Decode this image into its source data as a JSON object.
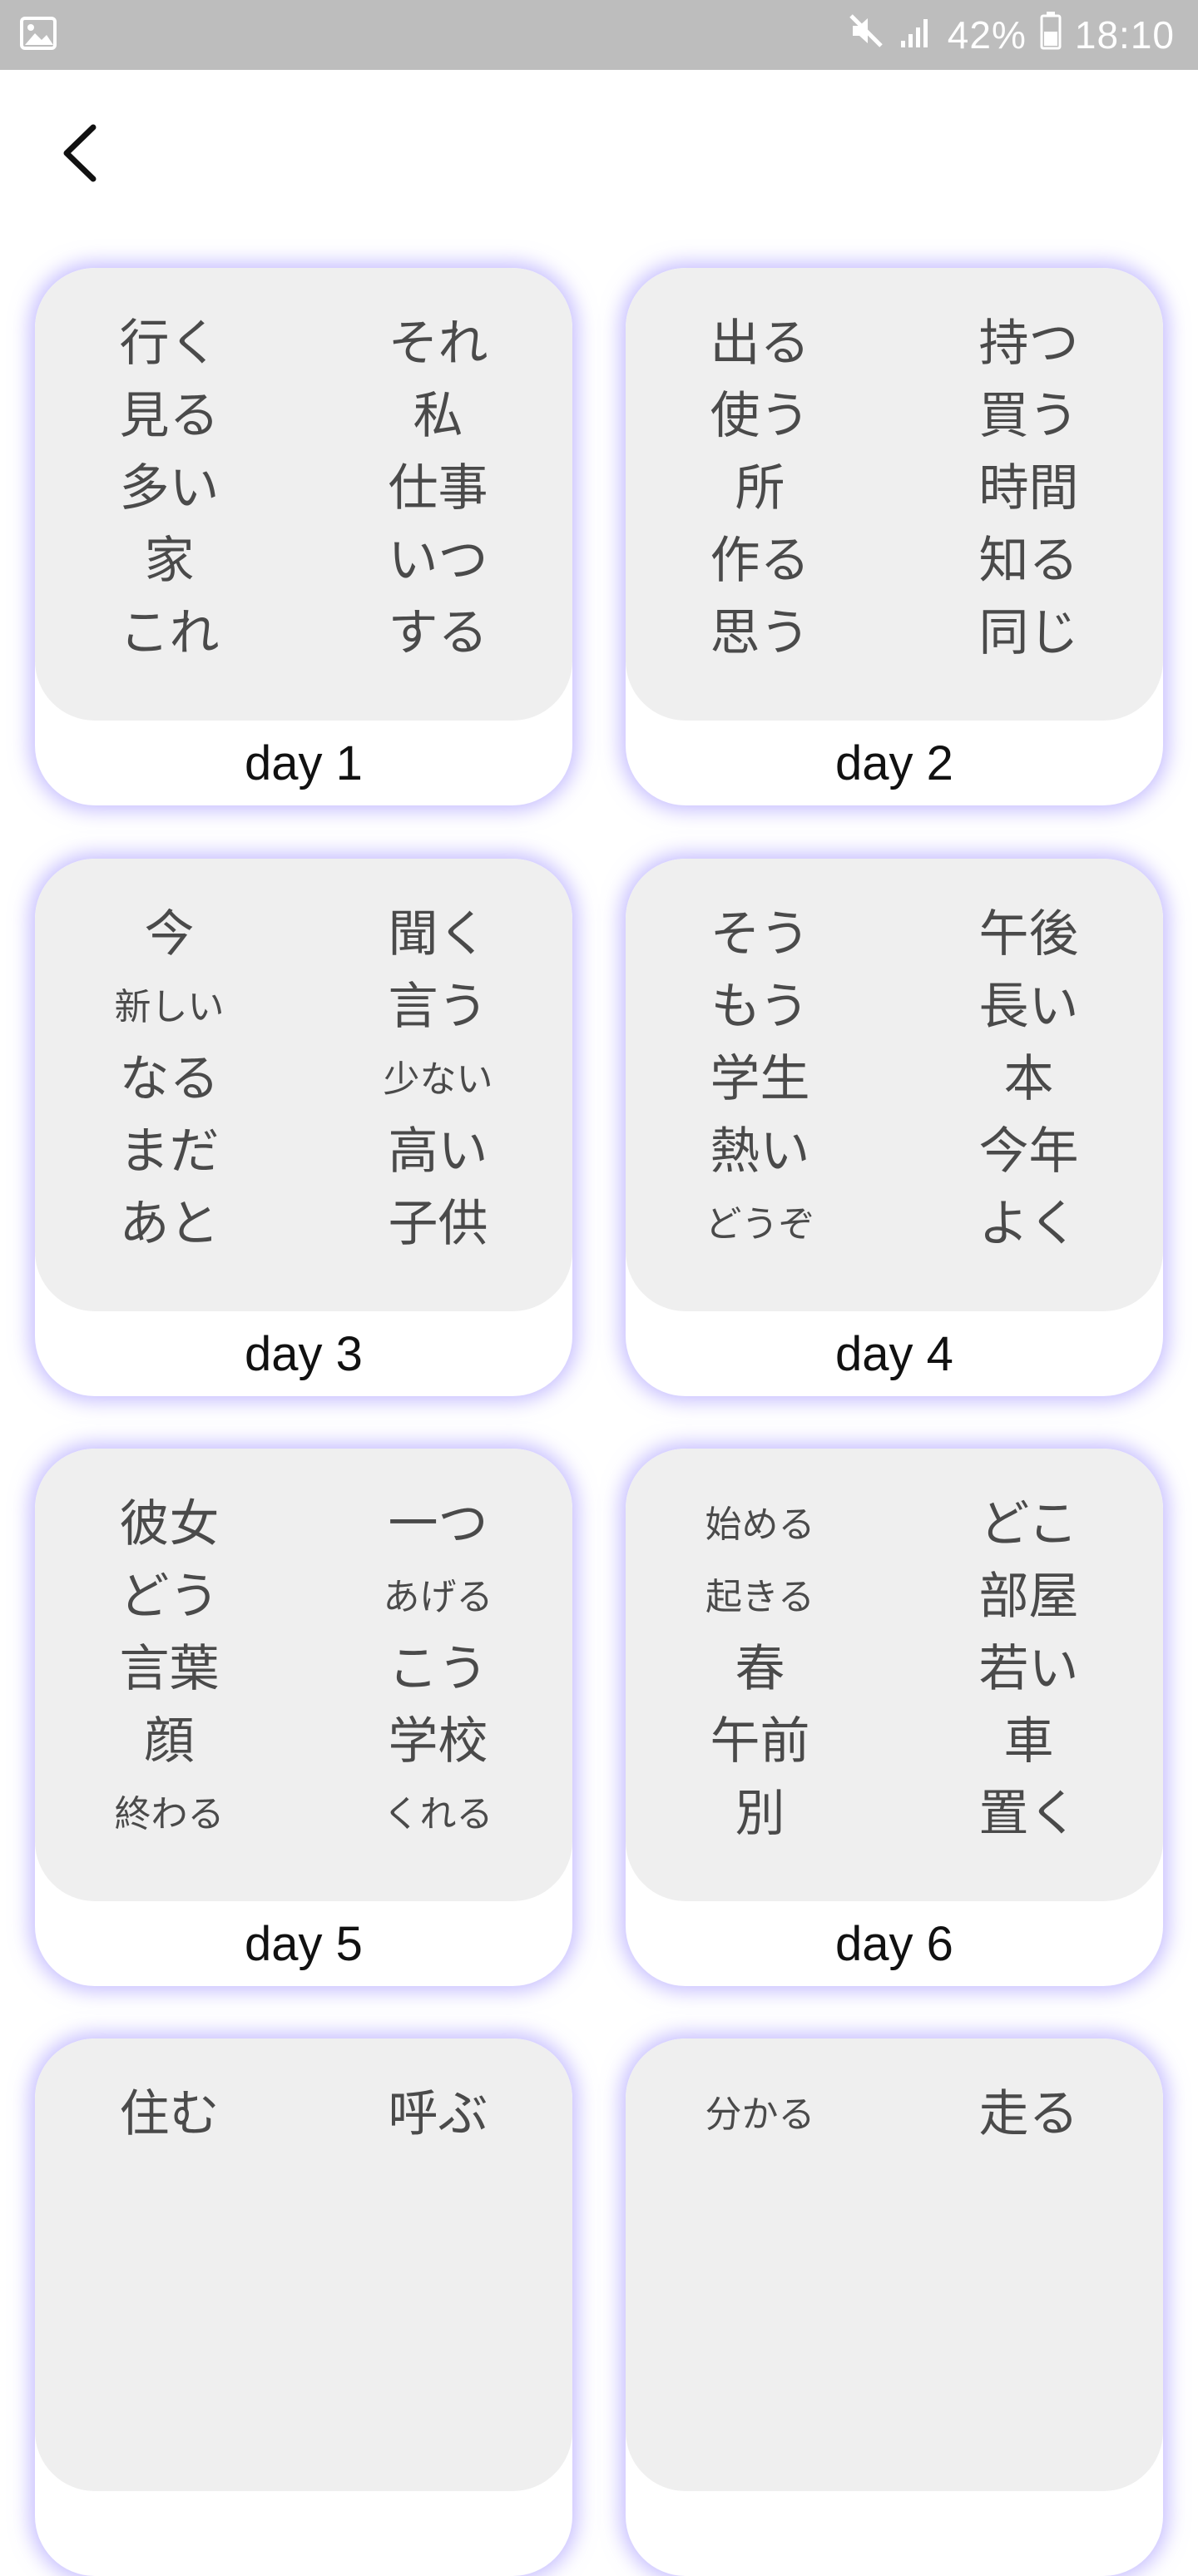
{
  "status_bar": {
    "battery_percent": "42%",
    "time": "18:10",
    "icons": [
      "image-icon",
      "mute-icon",
      "signal-icon",
      "battery-icon"
    ]
  },
  "header": {
    "back_icon": "chevron-left-icon"
  },
  "cards": [
    {
      "label": "day 1",
      "left": [
        "行く",
        "見る",
        "多い",
        "家",
        "これ"
      ],
      "right": [
        "それ",
        "私",
        "仕事",
        "いつ",
        "する"
      ]
    },
    {
      "label": "day 2",
      "left": [
        "出る",
        "使う",
        "所",
        "作る",
        "思う"
      ],
      "right": [
        "持つ",
        "買う",
        "時間",
        "知る",
        "同じ"
      ]
    },
    {
      "label": "day 3",
      "left": [
        "今",
        "新しい",
        "なる",
        "まだ",
        "あと"
      ],
      "right": [
        "聞く",
        "言う",
        "少ない",
        "高い",
        "子供"
      ]
    },
    {
      "label": "day 4",
      "left": [
        "そう",
        "もう",
        "学生",
        "熱い",
        "どうぞ"
      ],
      "right": [
        "午後",
        "長い",
        "本",
        "今年",
        "よく"
      ]
    },
    {
      "label": "day 5",
      "left": [
        "彼女",
        "どう",
        "言葉",
        "顔",
        "終わる"
      ],
      "right": [
        "一つ",
        "あげる",
        "こう",
        "学校",
        "くれる"
      ]
    },
    {
      "label": "day 6",
      "left": [
        "始める",
        "起きる",
        "春",
        "午前",
        "別"
      ],
      "right": [
        "どこ",
        "部屋",
        "若い",
        "車",
        "置く"
      ]
    },
    {
      "label": "",
      "left": [
        "住む"
      ],
      "right": [
        "呼ぶ"
      ]
    },
    {
      "label": "",
      "left": [
        "分かる"
      ],
      "right": [
        "走る"
      ]
    }
  ]
}
